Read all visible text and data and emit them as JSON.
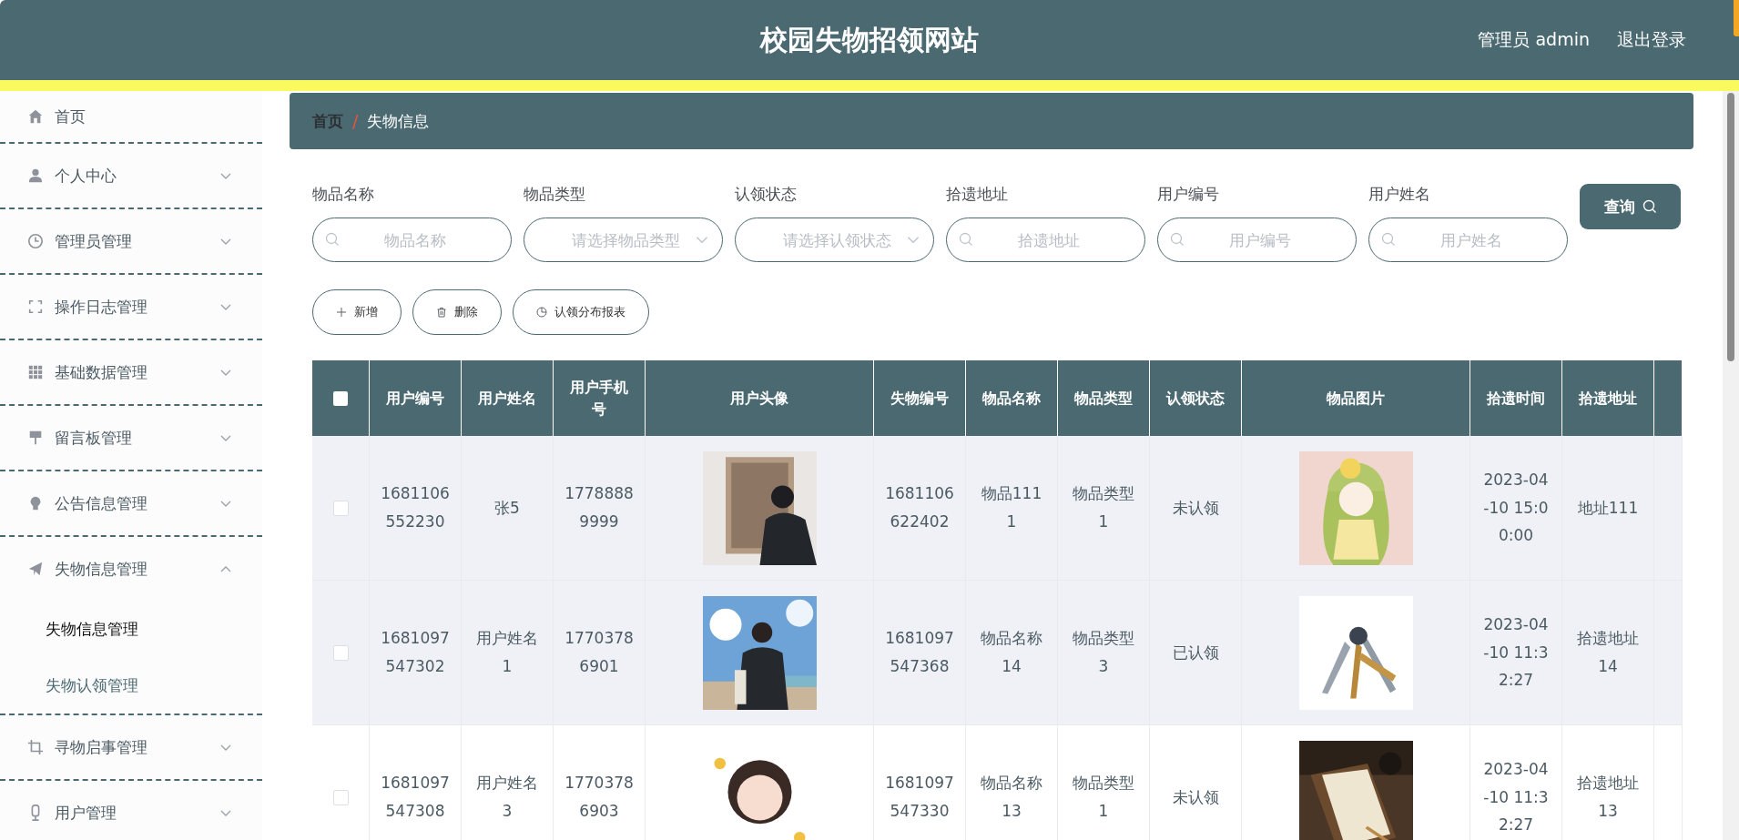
{
  "header": {
    "title": "校园失物招领网站",
    "user": "管理员 admin",
    "logout": "退出登录"
  },
  "sidebar": {
    "items": [
      {
        "label": "首页",
        "kind": "link"
      },
      {
        "label": "个人中心",
        "kind": "menu",
        "expanded": false
      },
      {
        "label": "管理员管理",
        "kind": "menu",
        "expanded": false
      },
      {
        "label": "操作日志管理",
        "kind": "menu",
        "expanded": false
      },
      {
        "label": "基础数据管理",
        "kind": "menu",
        "expanded": false
      },
      {
        "label": "留言板管理",
        "kind": "menu",
        "expanded": false
      },
      {
        "label": "公告信息管理",
        "kind": "menu",
        "expanded": false
      },
      {
        "label": "失物信息管理",
        "kind": "menu",
        "expanded": true,
        "children": [
          {
            "label": "失物信息管理",
            "selected": true
          },
          {
            "label": "失物认领管理",
            "selected": false
          }
        ]
      },
      {
        "label": "寻物启事管理",
        "kind": "menu",
        "expanded": false
      },
      {
        "label": "用户管理",
        "kind": "menu",
        "expanded": false
      }
    ]
  },
  "breadcrumb": {
    "separator": "/",
    "items": [
      "首页",
      "失物信息"
    ]
  },
  "filters": [
    {
      "label": "物品名称",
      "kind": "text",
      "placeholder": "物品名称"
    },
    {
      "label": "物品类型",
      "kind": "select",
      "placeholder": "请选择物品类型"
    },
    {
      "label": "认领状态",
      "kind": "select",
      "placeholder": "请选择认领状态"
    },
    {
      "label": "拾遗地址",
      "kind": "text",
      "placeholder": "拾遗地址"
    },
    {
      "label": "用户编号",
      "kind": "text",
      "placeholder": "用户编号"
    },
    {
      "label": "用户姓名",
      "kind": "text",
      "placeholder": "用户姓名"
    }
  ],
  "search_button": "查询",
  "actions": [
    {
      "label": "新增",
      "kind": "add"
    },
    {
      "label": "删除",
      "kind": "delete"
    },
    {
      "label": "认领分布报表",
      "kind": "chart"
    }
  ],
  "table": {
    "select_all": false,
    "columns": [
      "用户编号",
      "用户姓名",
      "用户手机号",
      "用户头像",
      "失物编号",
      "物品名称",
      "物品类型",
      "认领状态",
      "物品图片",
      "拾遗时间",
      "拾遗地址"
    ],
    "rows": [
      {
        "checked": false,
        "highlighted": true,
        "cells": [
          "1681106552230",
          "张5",
          "17788889999",
          {
            "kind": "picture"
          },
          "1681106622402",
          "物品1111",
          "物品类型1",
          "未认领",
          {
            "kind": "picture"
          },
          "2023-04-10 15:00:00",
          "地址111"
        ]
      },
      {
        "checked": false,
        "highlighted": true,
        "cells": [
          "1681097547302",
          "用户姓名1",
          "17703786901",
          {
            "kind": "picture"
          },
          "1681097547368",
          "物品名称14",
          "物品类型3",
          "已认领",
          {
            "kind": "picture"
          },
          "2023-04-10 11:32:27",
          "拾遗地址14"
        ]
      },
      {
        "checked": false,
        "highlighted": false,
        "cells": [
          "1681097547308",
          "用户姓名3",
          "17703786903",
          {
            "kind": "picture"
          },
          "1681097547330",
          "物品名称13",
          "物品类型1",
          "未认领",
          {
            "kind": "picture"
          },
          "2023-04-10 11:32:27",
          "拾遗地址13"
        ]
      }
    ]
  }
}
